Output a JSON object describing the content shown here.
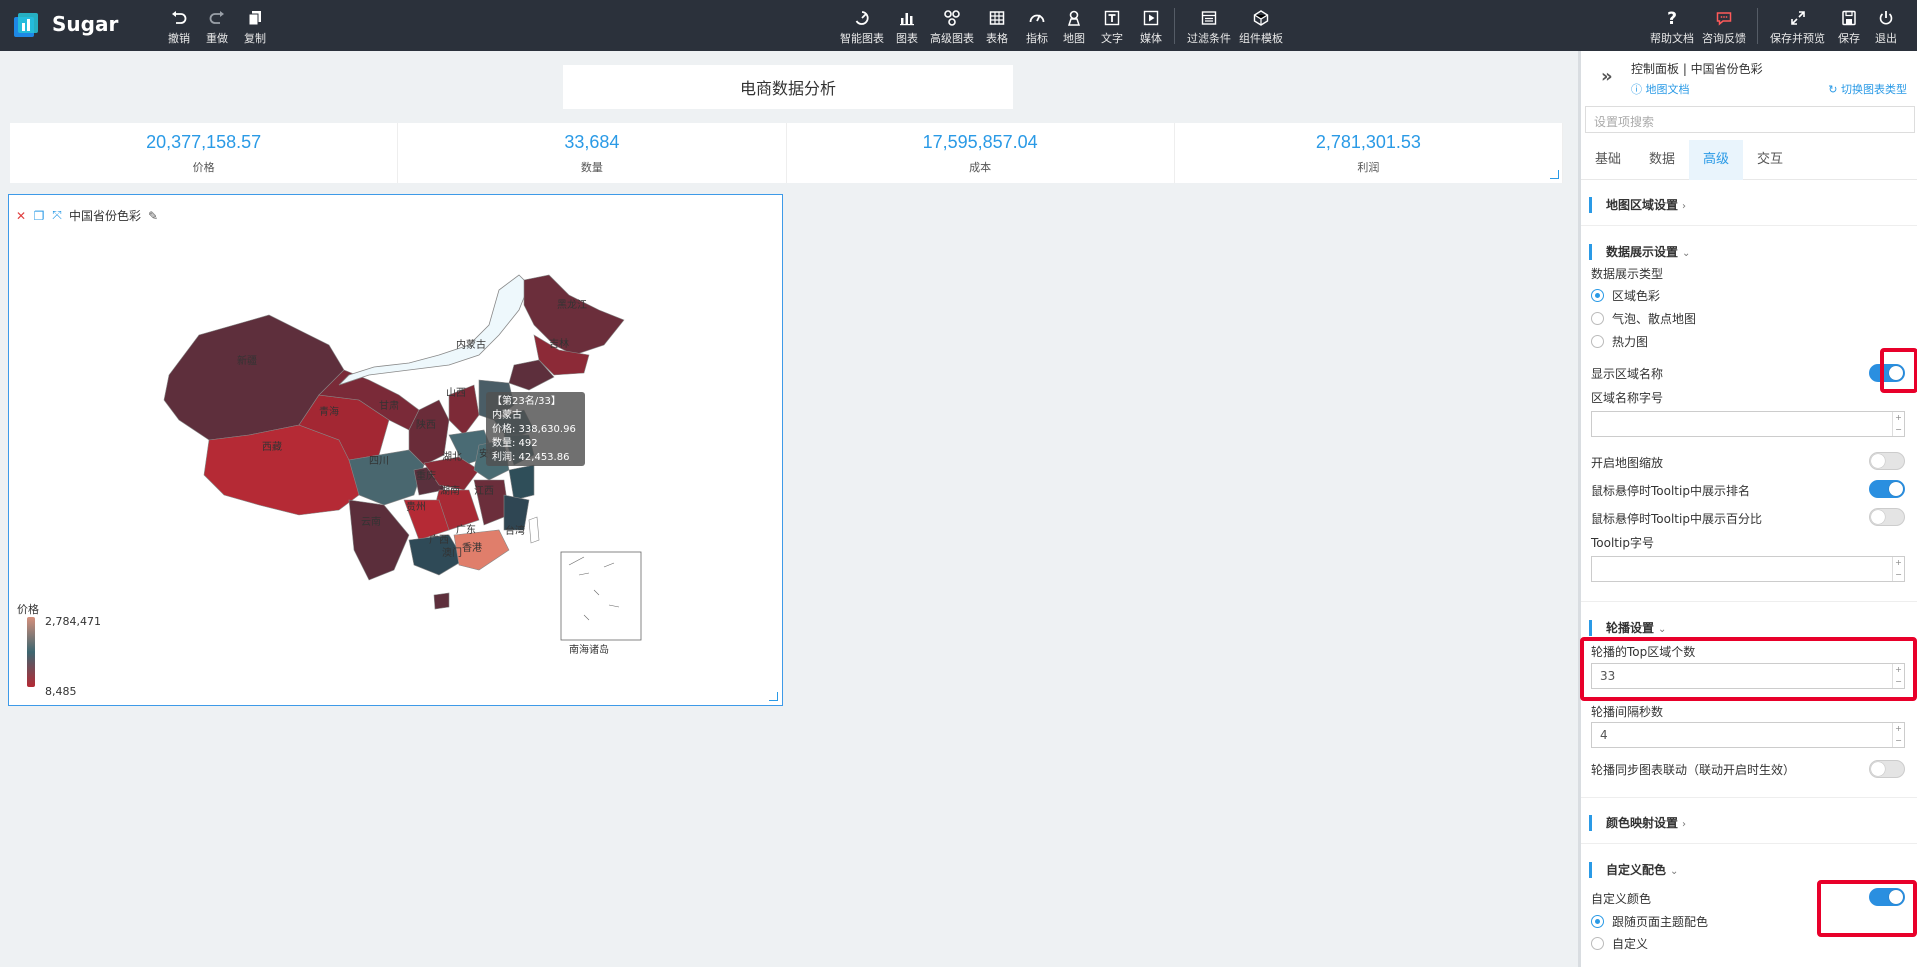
{
  "app": {
    "name": "Sugar"
  },
  "toolbar_left": [
    {
      "id": "undo",
      "label": "撤销"
    },
    {
      "id": "redo",
      "label": "重做"
    },
    {
      "id": "copy",
      "label": "复制"
    }
  ],
  "toolbar_center": [
    {
      "id": "smart-chart",
      "label": "智能图表"
    },
    {
      "id": "chart",
      "label": "图表"
    },
    {
      "id": "advanced-chart",
      "label": "高级图表"
    },
    {
      "id": "table",
      "label": "表格"
    },
    {
      "id": "indicator",
      "label": "指标"
    },
    {
      "id": "map",
      "label": "地图"
    },
    {
      "id": "text",
      "label": "文字"
    },
    {
      "id": "media",
      "label": "媒体"
    },
    {
      "id": "filter",
      "label": "过滤条件"
    },
    {
      "id": "template",
      "label": "组件模板"
    }
  ],
  "toolbar_right": [
    {
      "id": "help",
      "label": "帮助文档"
    },
    {
      "id": "feedback",
      "label": "咨询反馈"
    },
    {
      "id": "save-preview",
      "label": "保存并预览"
    },
    {
      "id": "save",
      "label": "保存"
    },
    {
      "id": "exit",
      "label": "退出"
    }
  ],
  "dashboard": {
    "title": "电商数据分析",
    "metrics": [
      {
        "value": "20,377,158.57",
        "label": "价格"
      },
      {
        "value": "33,684",
        "label": "数量"
      },
      {
        "value": "17,595,857.04",
        "label": "成本"
      },
      {
        "value": "2,781,301.53",
        "label": "利润"
      }
    ]
  },
  "map_card": {
    "title": "中国省份色彩",
    "province_labels": [
      "黑龙江",
      "吉林",
      "内蒙古",
      "新疆",
      "青海",
      "西藏",
      "甘肃",
      "陕西",
      "山西",
      "四川",
      "重庆",
      "湖北",
      "安徽",
      "江西",
      "湖南",
      "贵州",
      "云南",
      "广西",
      "广东",
      "香港",
      "澳门",
      "台湾",
      "南海诸岛"
    ],
    "tooltip": {
      "rank": "【第23名/33】",
      "name": "内蒙古",
      "price": "价格: 338,630.96",
      "qty": "数量: 492",
      "profit": "利润: 42,453.86"
    },
    "legend": {
      "title": "价格",
      "max": "2,784,471",
      "min": "8,485"
    }
  },
  "panel": {
    "title": "控制面板 | 中国省份色彩",
    "doc_link": "地图文档",
    "switch_link": "切换图表类型",
    "search_placeholder": "设置项搜索",
    "tabs": [
      "基础",
      "数据",
      "高级",
      "交互"
    ],
    "active_tab": "高级",
    "sections": {
      "region": "地图区域设置",
      "display": "数据展示设置",
      "carousel": "轮播设置",
      "color_map": "颜色映射设置",
      "custom_color": "自定义配色"
    },
    "display_type_label": "数据展示类型",
    "display_types": [
      "区域色彩",
      "气泡、散点地图",
      "热力图"
    ],
    "show_region_name": "显示区域名称",
    "region_font_size": "区域名称字号",
    "enable_zoom": "开启地图缩放",
    "tooltip_rank": "鼠标悬停时Tooltip中展示排名",
    "tooltip_percent": "鼠标悬停时Tooltip中展示百分比",
    "tooltip_font_size": "Tooltip字号",
    "carousel_top_label": "轮播的Top区域个数",
    "carousel_top_value": "33",
    "carousel_interval_label": "轮播间隔秒数",
    "carousel_interval_value": "4",
    "carousel_sync": "轮播同步图表联动（联动开启时生效）",
    "custom_color_label": "自定义颜色",
    "color_options": [
      "跟随页面主题配色",
      "自定义"
    ]
  },
  "colors": {
    "accent": "#2a9ae6",
    "highlight": "#e8002a",
    "topbar": "#2b313b"
  }
}
